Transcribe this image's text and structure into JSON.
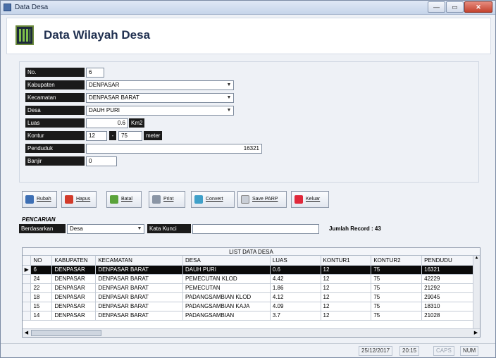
{
  "window": {
    "title": "Data Desa",
    "controls": [
      "—",
      "▭",
      "✕"
    ]
  },
  "header": {
    "title": "Data Wilayah Desa"
  },
  "form": {
    "no": {
      "label": "No.",
      "value": "6"
    },
    "kabupaten": {
      "label": "Kabupaten",
      "value": "DENPASAR"
    },
    "kecamatan": {
      "label": "Kecamatan",
      "value": "DENPASAR BARAT"
    },
    "desa": {
      "label": "Desa",
      "value": "DAUH PURI"
    },
    "luas": {
      "label": "Luas",
      "value": "0.6",
      "unit": "Km2"
    },
    "kontur": {
      "label": "Kontur",
      "value1": "12",
      "separator": "-",
      "value2": "75",
      "unit": "meter"
    },
    "penduduk": {
      "label": "Penduduk",
      "value": "16321"
    },
    "banjir": {
      "label": "Banjir",
      "value": "0"
    }
  },
  "toolbar": {
    "buttons": [
      {
        "label": "Rubah",
        "icon": "edit-icon"
      },
      {
        "label": "Hapus",
        "icon": "delete-icon"
      },
      {
        "label": "Batal",
        "icon": "cancel-icon"
      },
      {
        "label": "Print",
        "icon": "print-icon"
      },
      {
        "label": "Convert",
        "icon": "convert-icon"
      },
      {
        "label": "Save PARP",
        "icon": "save-icon"
      },
      {
        "label": "Keluar",
        "icon": "exit-icon"
      }
    ]
  },
  "search": {
    "title": "PENCARIAN",
    "by_label": "Berdasarkan",
    "by_value": "Desa",
    "keyword_label": "Kata Kunci",
    "keyword_value": "",
    "record_count": "Jumlah Record : 43"
  },
  "grid": {
    "caption": "LIST DATA DESA",
    "columns": [
      "NO",
      "KABUPATEN",
      "KECAMATAN",
      "DESA",
      "LUAS",
      "KONTUR1",
      "KONTUR2",
      "PENDUDU"
    ],
    "rows": [
      [
        "6",
        "DENPASAR",
        "DENPASAR BARAT",
        "DAUH PURI",
        "0.6",
        "12",
        "75",
        "16321"
      ],
      [
        "24",
        "DENPASAR",
        "DENPASAR BARAT",
        "PEMECUTAN KLOD",
        "4.42",
        "12",
        "75",
        "42229"
      ],
      [
        "22",
        "DENPASAR",
        "DENPASAR BARAT",
        "PEMECUTAN",
        "1.86",
        "12",
        "75",
        "21292"
      ],
      [
        "18",
        "DENPASAR",
        "DENPASAR BARAT",
        "PADANGSAMBIAN KLOD",
        "4.12",
        "12",
        "75",
        "29045"
      ],
      [
        "15",
        "DENPASAR",
        "DENPASAR BARAT",
        "PADANGSAMBIAN KAJA",
        "4.09",
        "12",
        "75",
        "18310"
      ],
      [
        "14",
        "DENPASAR",
        "DENPASAR BARAT",
        "PADANGSAMBIAN",
        "3.7",
        "12",
        "75",
        "21028"
      ]
    ],
    "selected_row": 0
  },
  "status": {
    "date": "25/12/2017",
    "time": "20:15",
    "caps": "CAPS",
    "num": "NUM"
  }
}
